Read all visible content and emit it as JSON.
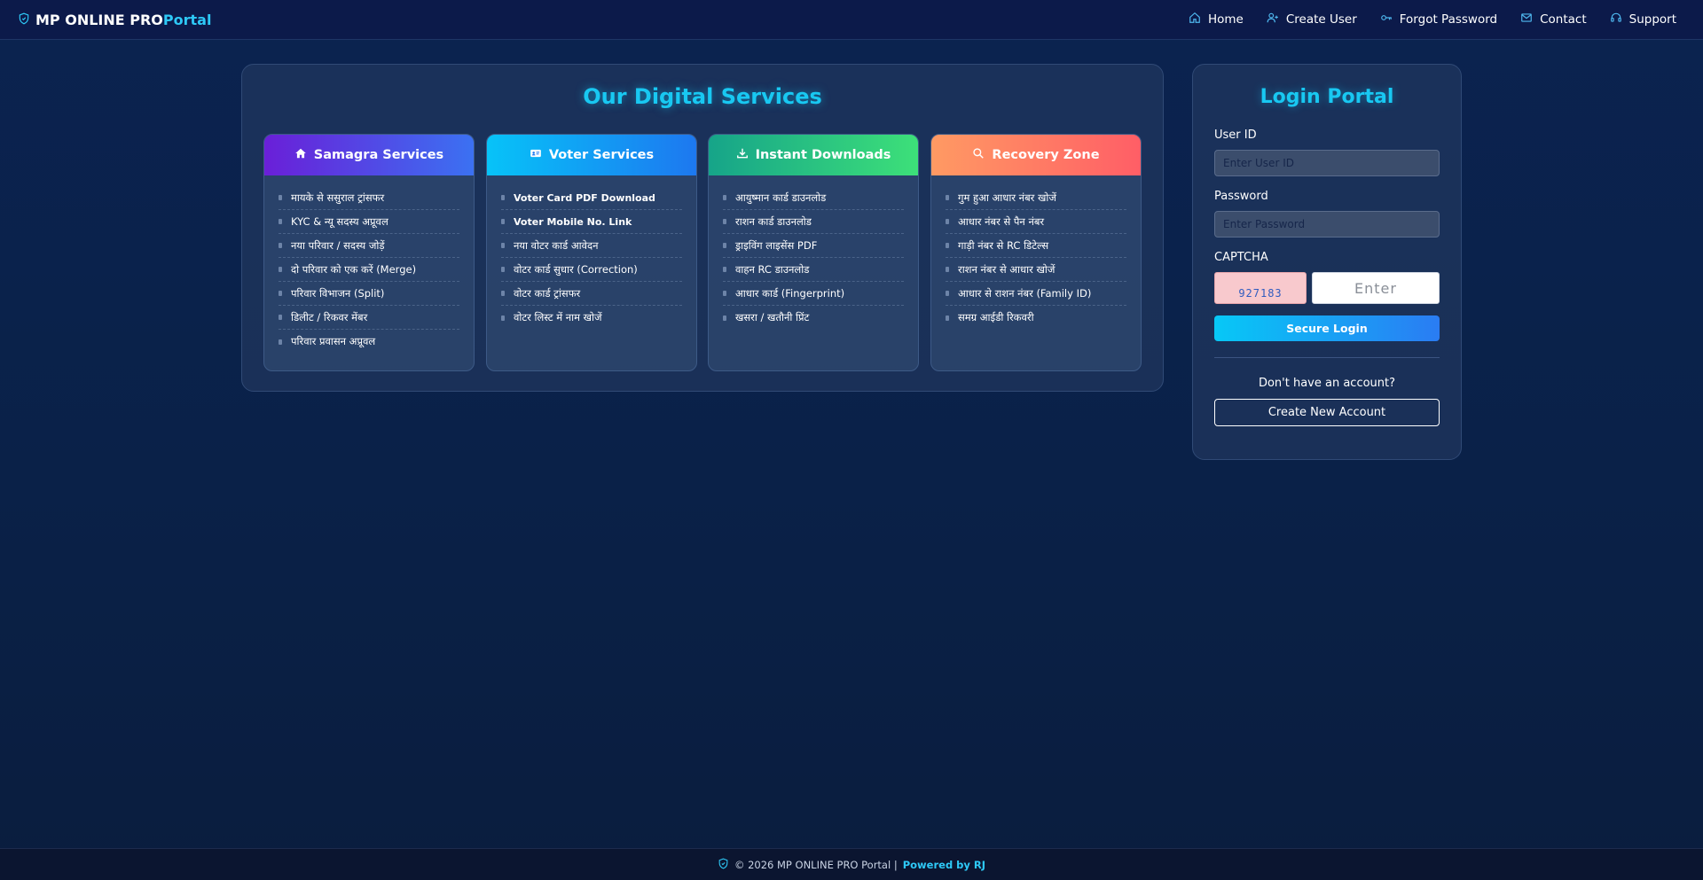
{
  "navbar": {
    "brand_main": "MP ONLINE PRO",
    "brand_accent": "Portal",
    "links": [
      {
        "label": "Home",
        "icon": "home-icon"
      },
      {
        "label": "Create User",
        "icon": "user-plus-icon"
      },
      {
        "label": "Forgot Password",
        "icon": "key-icon"
      },
      {
        "label": "Contact",
        "icon": "envelope-icon"
      },
      {
        "label": "Support",
        "icon": "headset-icon"
      }
    ]
  },
  "services": {
    "title": "Our Digital Services",
    "cards": [
      {
        "title": "Samagra Services",
        "icon": "home-icon",
        "header_gradient": [
          "#6a1fd8",
          "#3b71f2"
        ],
        "items": [
          "मायके से ससुराल ट्रांसफर",
          "KYC & न्यू सदस्य अप्रूवल",
          "नया परिवार / सदस्य जोड़ें",
          "दो परिवार को एक करें (Merge)",
          "परिवार विभाजन (Split)",
          "डिलीट / रिकवर मेंबर",
          "परिवार प्रवासन अप्रूवल"
        ]
      },
      {
        "title": "Voter Services",
        "icon": "id-card-icon",
        "header_gradient": [
          "#07c3f8",
          "#1d78f0"
        ],
        "items": [
          "Voter Card PDF Download",
          "Voter Mobile No. Link",
          "नया वोटर कार्ड आवेदन",
          "वोटर कार्ड सुधार (Correction)",
          "वोटर कार्ड ट्रांसफर",
          "वोटर लिस्ट में नाम खोजें"
        ]
      },
      {
        "title": "Instant Downloads",
        "icon": "download-icon",
        "header_gradient": [
          "#16a489",
          "#3de079"
        ],
        "items": [
          "आयुष्मान कार्ड डाउनलोड",
          "राशन कार्ड डाउनलोड",
          "ड्राइविंग लाइसेंस PDF",
          "वाहन RC डाउनलोड",
          "आधार कार्ड (Fingerprint)",
          "खसरा / खतौनी प्रिंट"
        ]
      },
      {
        "title": "Recovery Zone",
        "icon": "search-icon",
        "header_gradient": [
          "#ff9a63",
          "#ff5e66"
        ],
        "items": [
          "गुम हुआ आधार नंबर खोजें",
          "आधार नंबर से पैन नंबर",
          "गाड़ी नंबर से RC डिटेल्स",
          "राशन नंबर से आधार खोजें",
          "आधार से राशन नंबर (Family ID)",
          "समग्र आईडी रिकवरी"
        ]
      }
    ]
  },
  "login": {
    "title": "Login Portal",
    "user_id_label": "User ID",
    "user_id_placeholder": "Enter User ID",
    "password_label": "Password",
    "password_placeholder": "Enter Password",
    "captcha_label": "CAPTCHA",
    "captcha_code": "927183",
    "captcha_placeholder": "Enter",
    "submit_label": "Secure Login",
    "signup_prompt": "Don't have an account?",
    "signup_button": "Create New Account"
  },
  "footer": {
    "copyright": "© 2026 MP ONLINE PRO Portal |",
    "powered_by": "Powered by RJ"
  },
  "colors": {
    "accent": "#18c8f2",
    "navbar_bg": "#0c1a4a",
    "page_bg": "#0b2350"
  }
}
